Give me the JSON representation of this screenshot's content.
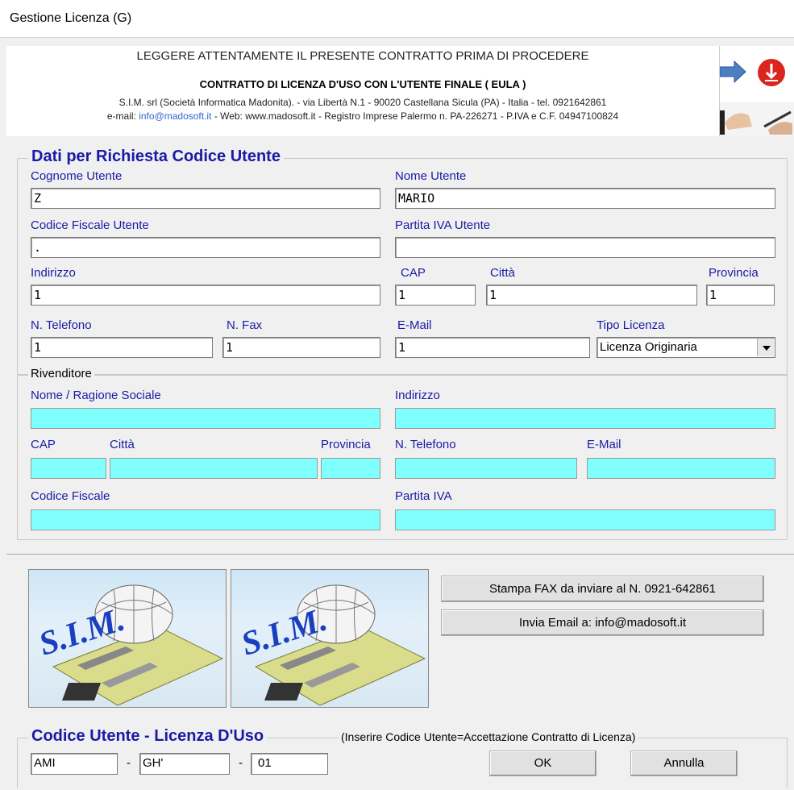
{
  "window": {
    "title": "Gestione Licenza (G)"
  },
  "header": {
    "line1": "LEGGERE ATTENTAMENTE IL PRESENTE CONTRATTO PRIMA DI PROCEDERE",
    "line2": "CONTRATTO DI LICENZA D'USO CON L'UTENTE FINALE ( EULA )",
    "line3": "S.I.M. srl (Società Informatica Madonita). - via Libertà N.1 - 90020 Castellana Sicula (PA) - Italia - tel. 0921642861",
    "line4_prefix": "e-mail: ",
    "line4_email": "info@madosoft.it",
    "line4_rest": " - Web: www.madosoft.it - Registro Imprese Palermo n. PA-226271 - P.IVA e C.F. 04947100824"
  },
  "user": {
    "group_title": "Dati per  Richiesta Codice Utente",
    "cognome_label": "Cognome Utente",
    "cognome_value": "Z",
    "nome_label": "Nome Utente",
    "nome_value": "MARIO",
    "cf_label": "Codice Fiscale Utente",
    "cf_value": ".",
    "piva_label": "Partita IVA Utente",
    "piva_value": "",
    "indirizzo_label": "Indirizzo",
    "indirizzo_value": "1",
    "cap_label": "CAP",
    "cap_value": "1",
    "citta_label": "Città",
    "citta_value": "1",
    "provincia_label": "Provincia",
    "provincia_value": "1",
    "tel_label": "N. Telefono",
    "tel_value": "1",
    "fax_label": "N. Fax",
    "fax_value": "1",
    "email_label": "E-Mail",
    "email_value": "1",
    "tipo_label": "Tipo Licenza",
    "tipo_value": "Licenza Originaria"
  },
  "reseller": {
    "group_title": "Rivenditore",
    "nome_label": "Nome / Ragione Sociale",
    "indirizzo_label": "Indirizzo",
    "cap_label": "CAP",
    "citta_label": "Città",
    "provincia_label": "Provincia",
    "tel_label": "N. Telefono",
    "email_label": "E-Mail",
    "cf_label": "Codice Fiscale",
    "piva_label": "Partita IVA"
  },
  "actions": {
    "fax_button": "Stampa FAX da inviare al N. 0921-642861",
    "email_button": "Invia Email a:  info@madosoft.it",
    "logo_text": "S.I.M."
  },
  "license": {
    "group_title": "Codice Utente  -  Licenza D'Uso",
    "hint": "(Inserire Codice Utente=Accettazione Contratto di Licenza)",
    "code1": "AMI",
    "dash1": "-",
    "code2": "GH'",
    "dash2": "-",
    "code3": "01",
    "ok_button": "OK",
    "cancel_button": "Annulla"
  },
  "colors": {
    "label_blue": "#1a1aa6",
    "reseller_field": "#80ffff",
    "arrow": "#4a7fc1",
    "pdf_red": "#d9251d"
  }
}
